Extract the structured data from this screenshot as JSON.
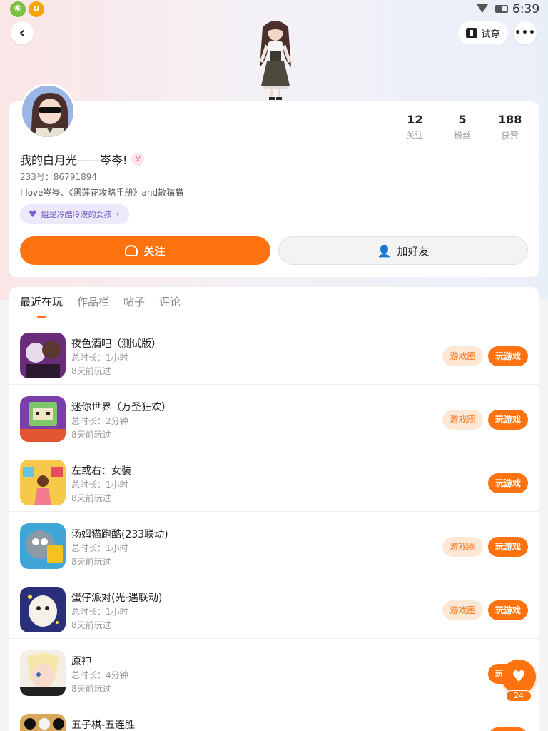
{
  "status_bar": {
    "time": "6:39"
  },
  "header": {
    "tryon_label": "试穿",
    "more_label": "•••",
    "back_label": "‹"
  },
  "profile": {
    "stats": [
      {
        "num": "12",
        "label": "关注"
      },
      {
        "num": "5",
        "label": "粉丝"
      },
      {
        "num": "188",
        "label": "获赞"
      }
    ],
    "nickname": "我的白月光——岑岑!",
    "uid": "233号：86791894",
    "bio": "I love岑岑、《黑莲花攻略手册》and散猫猫",
    "tag": "姐是冷酷冷漠的女孩",
    "follow_label": "关注",
    "add_friend_label": "加好友"
  },
  "tabs": [
    "最近在玩",
    "作品栏",
    "帖子",
    "评论"
  ],
  "games": [
    {
      "name": "夜色酒吧（测试版）",
      "duration": "总时长：1小时",
      "last": "8天前玩过",
      "has_circle": true
    },
    {
      "name": "迷你世界（万圣狂欢）",
      "duration": "总时长：2分钟",
      "last": "8天前玩过",
      "has_circle": true
    },
    {
      "name": "左或右：女装",
      "duration": "总时长：1小时",
      "last": "8天前玩过",
      "has_circle": false
    },
    {
      "name": "汤姆猫跑酷(233联动)",
      "duration": "总时长：1小时",
      "last": "8天前玩过",
      "has_circle": true
    },
    {
      "name": "蛋仔派对(光·遇联动)",
      "duration": "总时长：1小时",
      "last": "8天前玩过",
      "has_circle": true
    },
    {
      "name": "原神",
      "duration": "总时长：4分钟",
      "last": "8天前玩过",
      "has_circle": false
    },
    {
      "name": "五子棋-五连胜",
      "duration": "",
      "last": "",
      "has_circle": false
    }
  ],
  "game_buttons": {
    "circle": "游戏圈",
    "play": "玩游戏"
  },
  "fab": {
    "count": "24",
    "icon": "heart-icon"
  },
  "colors": {
    "accent": "#ff7210",
    "accent_light": "#fde8d8",
    "tag_bg": "#ede9fb"
  }
}
